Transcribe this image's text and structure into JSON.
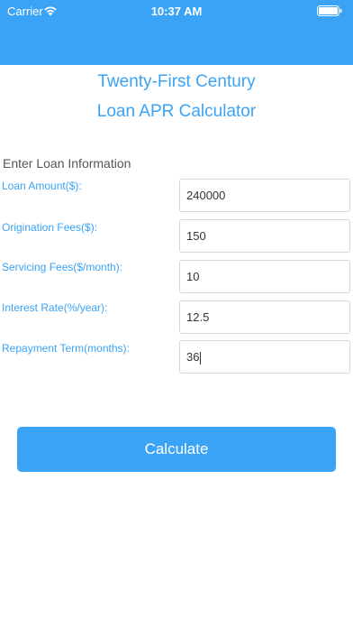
{
  "status_bar": {
    "carrier": "Carrier",
    "time": "10:37 AM",
    "color": "#3aa3f5",
    "icons": [
      "wifi-icon",
      "battery-icon"
    ]
  },
  "header": {
    "line1": "Twenty-First Century",
    "line2": "Loan APR Calculator"
  },
  "form": {
    "section_title": "Enter Loan Information",
    "fields": [
      {
        "label": "Loan Amount($):",
        "value": "240000"
      },
      {
        "label": "Origination Fees($):",
        "value": "150"
      },
      {
        "label": "Servicing Fees($/month):",
        "value": "10"
      },
      {
        "label": "Interest Rate(%/year):",
        "value": "12.5"
      },
      {
        "label": "Repayment Term(months):",
        "value": "36"
      }
    ]
  },
  "calculate_button": {
    "label": "Calculate"
  },
  "colors": {
    "accent": "#3aa3f5"
  }
}
